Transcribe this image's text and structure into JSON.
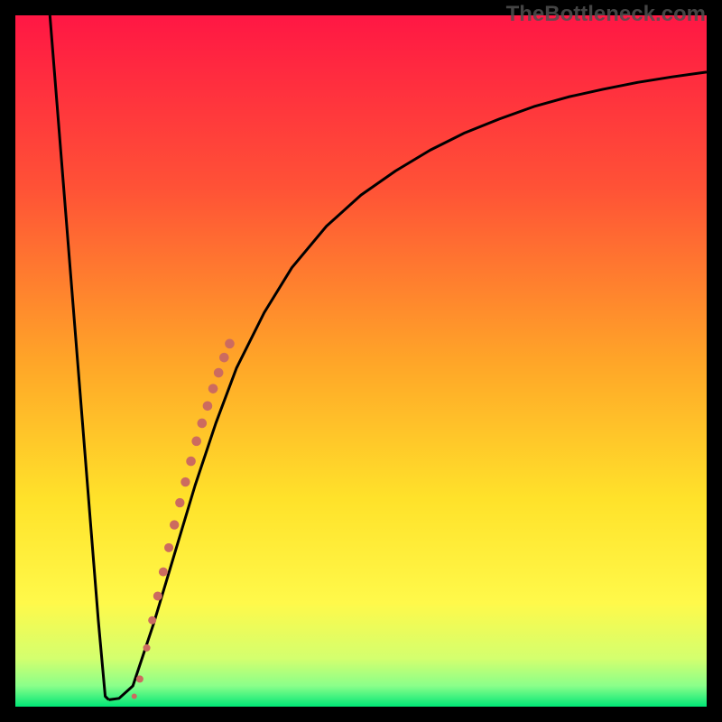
{
  "watermark": "TheBottleneck.com",
  "chart_data": {
    "type": "line",
    "title": "",
    "xlabel": "",
    "ylabel": "",
    "xlim": [
      0,
      100
    ],
    "ylim": [
      0,
      100
    ],
    "gradient_stops": [
      {
        "offset": 0,
        "color": "#ff1744"
      },
      {
        "offset": 25,
        "color": "#ff5236"
      },
      {
        "offset": 50,
        "color": "#ffa528"
      },
      {
        "offset": 70,
        "color": "#ffe22a"
      },
      {
        "offset": 85,
        "color": "#fff94a"
      },
      {
        "offset": 93,
        "color": "#d4ff6e"
      },
      {
        "offset": 97,
        "color": "#8aff8a"
      },
      {
        "offset": 100,
        "color": "#00e676"
      }
    ],
    "series": [
      {
        "name": "left-branch",
        "type": "line",
        "x": [
          5.0,
          6.0,
          7.0,
          8.0,
          9.0,
          10.0,
          11.0,
          12.0,
          13.0,
          13.5
        ],
        "y": [
          100,
          87.5,
          75,
          62.5,
          50,
          37.5,
          25,
          12.5,
          1.5,
          1.0
        ]
      },
      {
        "name": "right-branch",
        "type": "line",
        "x": [
          13.5,
          15,
          17,
          20,
          23,
          26,
          29,
          32,
          36,
          40,
          45,
          50,
          55,
          60,
          65,
          70,
          75,
          80,
          85,
          90,
          95,
          100
        ],
        "y": [
          1.0,
          1.2,
          3,
          12,
          22,
          32,
          41,
          49,
          57,
          63.5,
          69.5,
          74,
          77.5,
          80.5,
          83,
          85,
          86.8,
          88.2,
          89.3,
          90.3,
          91.1,
          91.8
        ]
      },
      {
        "name": "dotted-segment",
        "type": "scatter",
        "x": [
          17.2,
          18.0,
          19.0,
          19.8,
          20.6,
          21.4,
          22.2,
          23.0,
          23.8,
          24.6,
          25.4,
          26.2,
          27.0,
          27.8,
          28.6,
          29.4,
          30.2,
          31.0
        ],
        "y": [
          1.5,
          4.0,
          8.5,
          12.5,
          16.0,
          19.5,
          23.0,
          26.3,
          29.5,
          32.5,
          35.5,
          38.4,
          41.0,
          43.5,
          46.0,
          48.3,
          50.5,
          52.5
        ],
        "sizes": [
          3,
          4,
          4,
          4.5,
          5,
          5,
          5,
          5.2,
          5.2,
          5.2,
          5.3,
          5.3,
          5.3,
          5.3,
          5.3,
          5.3,
          5.3,
          5.3
        ],
        "color": "#cc6b5f"
      }
    ]
  }
}
